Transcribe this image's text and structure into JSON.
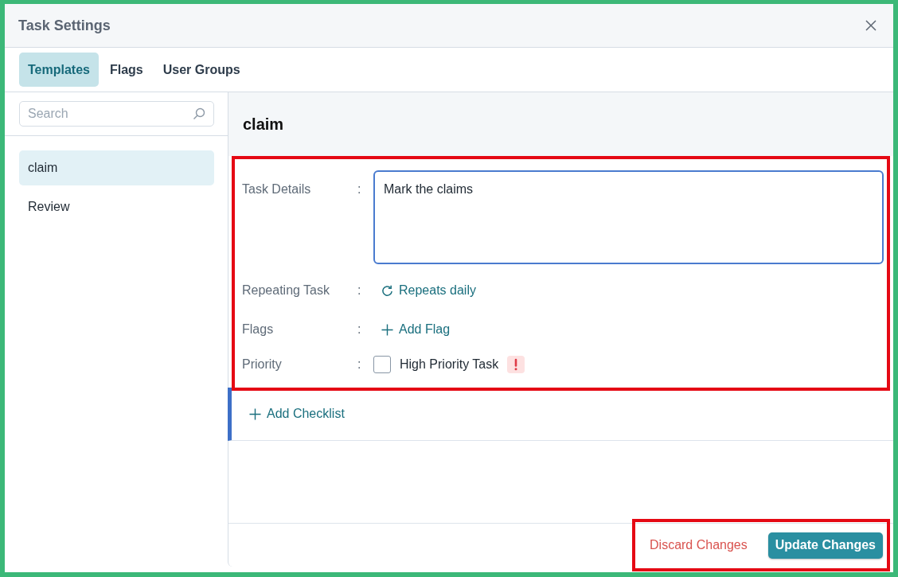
{
  "dialog": {
    "title": "Task Settings"
  },
  "tabs": [
    {
      "label": "Templates",
      "selected": true
    },
    {
      "label": "Flags",
      "selected": false
    },
    {
      "label": "User Groups",
      "selected": false
    }
  ],
  "sidebar": {
    "search": {
      "placeholder": "Search"
    },
    "items": [
      {
        "label": "claim",
        "selected": true
      },
      {
        "label": "Review",
        "selected": false
      }
    ]
  },
  "template": {
    "title": "claim",
    "fields": [
      {
        "kind": "textarea",
        "label": "Task Details",
        "separator": ":",
        "value": "Mark the claims"
      },
      {
        "kind": "repeat",
        "label": "Repeating Task",
        "separator": ":",
        "text": "Repeats daily"
      },
      {
        "kind": "add",
        "label": "Flags",
        "separator": ":",
        "text": "Add Flag"
      },
      {
        "kind": "checkbox",
        "label": "Priority",
        "separator": ":",
        "text": "High Priority Task",
        "checked": false
      }
    ],
    "add_checklist": "Add Checklist"
  },
  "footer": {
    "buttons": [
      {
        "kind": "danger",
        "label": "Discard Changes"
      },
      {
        "kind": "primary",
        "label": "Update Changes"
      }
    ]
  }
}
